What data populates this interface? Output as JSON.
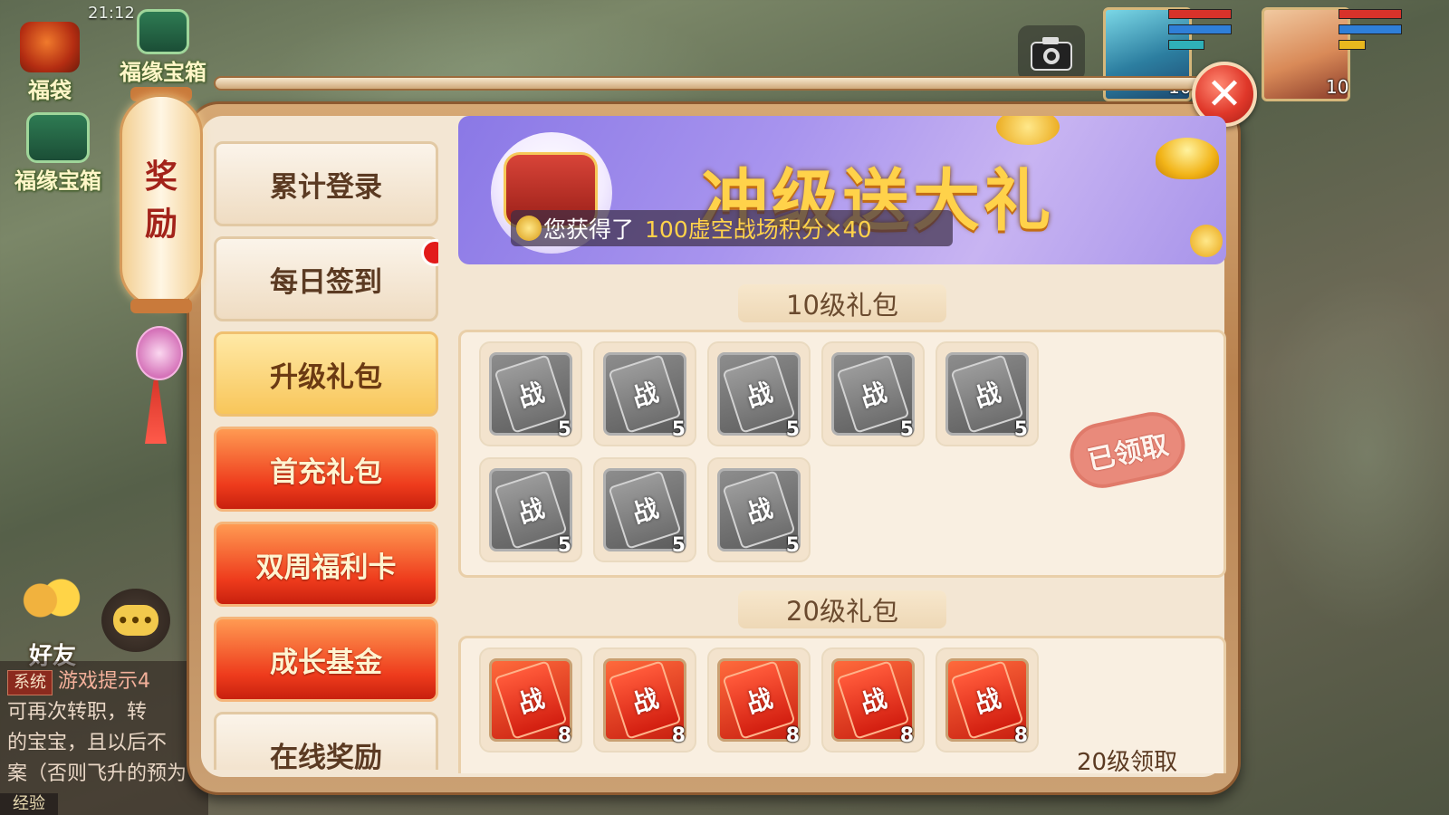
{
  "status": {
    "time": "21:12"
  },
  "hud": {
    "bag_label": "福袋",
    "chest_label_top": "福缘宝箱",
    "chest_label_left": "福缘宝箱",
    "hero_level": "10",
    "pet_level": "10",
    "friend_label": "好友",
    "chat_icon": "chat-bubble-icon"
  },
  "chat_log": {
    "tag": "系统",
    "line1": "游戏提示4",
    "line2": "可再次转职，转",
    "line3": "的宝宝，且以后不",
    "line4": "案（否则飞升的预为",
    "exp_label": "经验"
  },
  "panel": {
    "side_title_1": "奖",
    "side_title_2": "励",
    "close_symbol": "✕"
  },
  "menu": [
    {
      "label": "累计登录"
    },
    {
      "label": "每日签到"
    },
    {
      "label": "升级礼包"
    },
    {
      "label": "首充礼包"
    },
    {
      "label": "双周福利卡"
    },
    {
      "label": "成长基金"
    },
    {
      "label": "在线奖励"
    }
  ],
  "banner": {
    "title": "冲级送大礼",
    "toast_prefix": "您获得了",
    "toast_item": "100虚空战场积分×40"
  },
  "packs": [
    {
      "title": "10级礼包",
      "status": "已领取",
      "item_glyph": "战",
      "items": [
        "5",
        "5",
        "5",
        "5",
        "5",
        "5",
        "5",
        "5"
      ]
    },
    {
      "title": "20级礼包",
      "status": "20级领取",
      "item_glyph": "战",
      "items": [
        "8",
        "8",
        "8",
        "8",
        "8"
      ]
    }
  ],
  "colors": {
    "accent_red": "#e0382a",
    "gold": "#ffd24a",
    "active_tab": "#f8c65a"
  }
}
